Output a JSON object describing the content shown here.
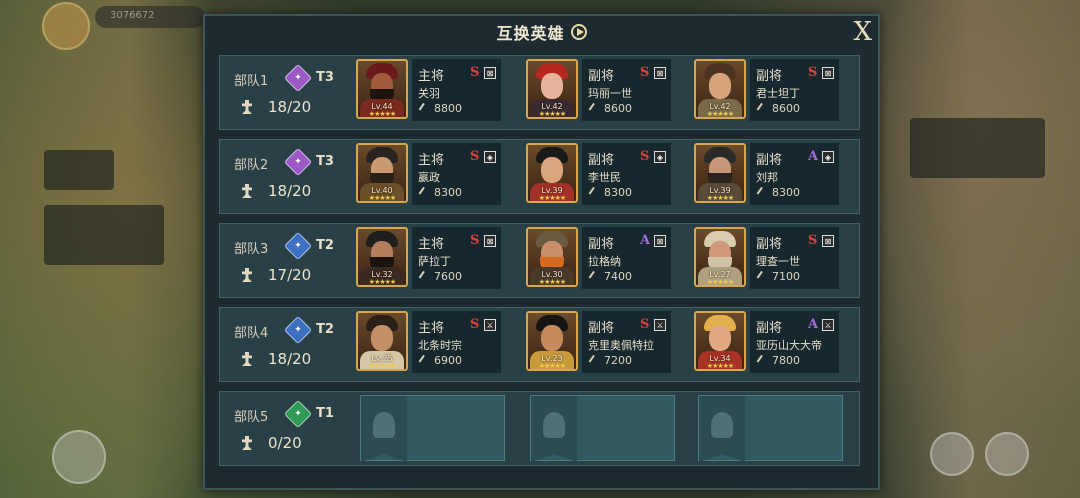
{
  "background": {
    "resource": "3076672"
  },
  "header": {
    "title": "互换英雄",
    "close": "X"
  },
  "squads": [
    {
      "name": "部队1",
      "tier": "T3",
      "tier_color": "#9b59c7",
      "troops": "18/20",
      "heroes": [
        {
          "role": "主将",
          "name": "关羽",
          "grade": "S",
          "level": "Lv.44",
          "power": "8800",
          "skill": "⊠",
          "hair": "#6a1a1a",
          "skin": "#a35a3a",
          "beard": "#1c1410",
          "body": "#7a2a1e"
        },
        {
          "role": "副将",
          "name": "玛丽一世",
          "grade": "S",
          "level": "Lv.42",
          "power": "8600",
          "skill": "⊠",
          "hair": "#b5281e",
          "skin": "#e5b39a",
          "beard": "transparent",
          "body": "#3a2a30"
        },
        {
          "role": "副将",
          "name": "君士坦丁",
          "grade": "S",
          "level": "Lv.42",
          "power": "8600",
          "skill": "⊠",
          "hair": "#4a3420",
          "skin": "#d6a27a",
          "beard": "transparent",
          "body": "#7a6a4a"
        }
      ]
    },
    {
      "name": "部队2",
      "tier": "T3",
      "tier_color": "#9b59c7",
      "troops": "18/20",
      "heroes": [
        {
          "role": "主将",
          "name": "嬴政",
          "grade": "S",
          "level": "Lv.40",
          "power": "8300",
          "skill": "◈",
          "hair": "#2a2420",
          "skin": "#c99a72",
          "beard": "#2a2018",
          "body": "#6b5028"
        },
        {
          "role": "副将",
          "name": "李世民",
          "grade": "S",
          "level": "Lv.39",
          "power": "8300",
          "skill": "◈",
          "hair": "#1a1a1a",
          "skin": "#d9a47e",
          "beard": "transparent",
          "body": "#a13028"
        },
        {
          "role": "副将",
          "name": "刘邦",
          "grade": "A",
          "level": "Lv.39",
          "power": "8300",
          "skill": "◈",
          "hair": "#2a2a2a",
          "skin": "#c8987a",
          "beard": "#2a2420",
          "body": "#5a4a38"
        }
      ]
    },
    {
      "name": "部队3",
      "tier": "T2",
      "tier_color": "#3d6fc2",
      "troops": "17/20",
      "heroes": [
        {
          "role": "主将",
          "name": "萨拉丁",
          "grade": "S",
          "level": "Lv.32",
          "power": "7600",
          "skill": "⊠",
          "hair": "#1e1e1e",
          "skin": "#b27e5a",
          "beard": "#1a1410",
          "body": "#3a2a22"
        },
        {
          "role": "副将",
          "name": "拉格纳",
          "grade": "A",
          "level": "Lv.30",
          "power": "7400",
          "skill": "⊠",
          "hair": "#6a5a40",
          "skin": "#c8906a",
          "beard": "#d86a20",
          "body": "#4a3a2a"
        },
        {
          "role": "副将",
          "name": "理查一世",
          "grade": "S",
          "level": "Lv.27",
          "power": "7100",
          "skill": "⊠",
          "hair": "#d8cbb0",
          "skin": "#d2987a",
          "beard": "#cfc2a6",
          "body": "#b0a080"
        }
      ]
    },
    {
      "name": "部队4",
      "tier": "T2",
      "tier_color": "#3d6fc2",
      "troops": "18/20",
      "heroes": [
        {
          "role": "主将",
          "name": "北条时宗",
          "grade": "S",
          "level": "Lv.25",
          "power": "6900",
          "skill": "⚔",
          "hair": "#2a2018",
          "skin": "#c48e66",
          "beard": "transparent",
          "body": "#d6c8a6"
        },
        {
          "role": "副将",
          "name": "克里奥佩特拉",
          "grade": "S",
          "level": "Lv.23",
          "power": "7200",
          "skill": "⚔",
          "hair": "#141414",
          "skin": "#c48a5a",
          "beard": "transparent",
          "body": "#c89a3a"
        },
        {
          "role": "副将",
          "name": "亚历山大大帝",
          "grade": "A",
          "level": "Lv.34",
          "power": "7800",
          "skill": "⚔",
          "hair": "#e2b04a",
          "skin": "#e0a880",
          "beard": "transparent",
          "body": "#a83226"
        }
      ]
    },
    {
      "name": "部队5",
      "tier": "T1",
      "tier_color": "#2f9a55",
      "troops": "0/20",
      "heroes": []
    }
  ],
  "colors": {
    "grade_S": "#e0403a",
    "grade_A": "#a46ae0",
    "stars": "★★★★★"
  }
}
